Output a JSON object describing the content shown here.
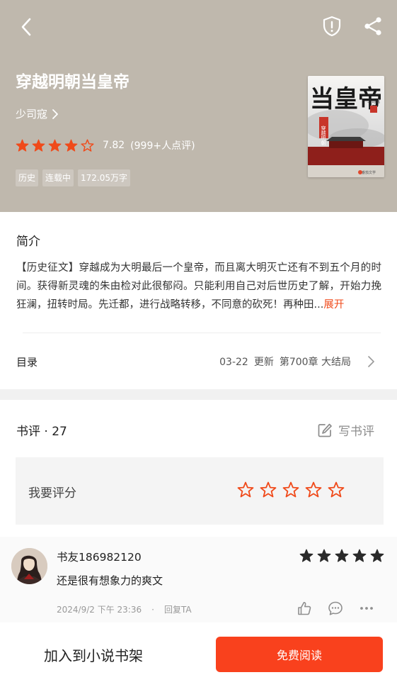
{
  "book": {
    "title": "穿越明朝当皇帝",
    "author": "少司寇",
    "rating_score": "7.82",
    "rating_count": "(999+人点评)",
    "rating_stars": 4.5,
    "tags": [
      "历史",
      "连载中",
      "172.05万字"
    ],
    "cover": {
      "title_text": "当皇帝",
      "subtitle_text": "穿越明朝",
      "author_text": "少司寇",
      "publisher_text": "番茄文学"
    }
  },
  "intro": {
    "title": "简介",
    "text": "【历史征文】穿越成为大明最后一个皇帝，而且离大明灭亡还有不到五个月的时间。获得新灵魂的朱由检对此很郁闷。只能利用自己对后世历史了解，开始力挽狂澜，扭转时局。先迁都，进行战略转移，不同意的砍死！再种田...",
    "expand_label": "展开"
  },
  "catalog": {
    "label": "目录",
    "update_date": "03-22",
    "update_label": "更新",
    "latest_chapter": "第700章 大结局"
  },
  "reviews": {
    "header": "书评 · 27",
    "write_label": "写书评",
    "rate_label": "我要评分",
    "rate_stars_count": 5,
    "items": [
      {
        "user": "书友186982120",
        "stars": 5,
        "text": "还是很有想象力的爽文",
        "time": "2024/9/2 下午 23:36",
        "separator": "·",
        "reply_label": "回复TA"
      }
    ]
  },
  "bottom": {
    "add_shelf_label": "加入到小说书架",
    "read_label": "免费阅读"
  },
  "colors": {
    "hero_bg": "#bfb8ad",
    "accent": "#f04a1a",
    "button": "#f9411d",
    "star_user": "#2a2a2a"
  }
}
